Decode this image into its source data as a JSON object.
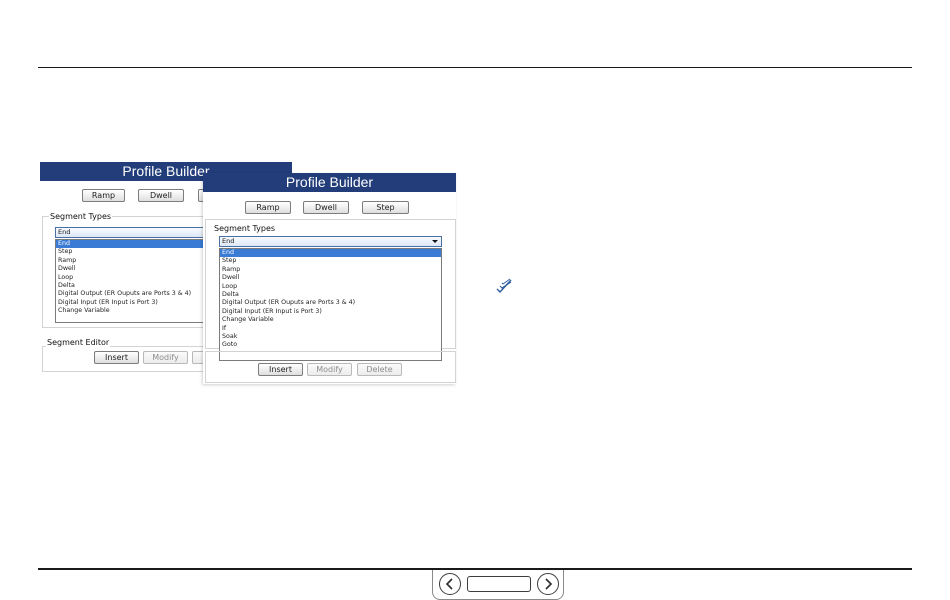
{
  "back_window": {
    "title": "Profile Builder",
    "toolbar": {
      "ramp": "Ramp",
      "dwell": "Dwell"
    },
    "segment_types_label": "Segment Types",
    "combo_value": "End",
    "list_items": [
      "End",
      "Step",
      "Ramp",
      "Dwell",
      "Loop",
      "Delta",
      "Digital Output (ER Ouputs are Ports 3 & 4)",
      "Digital Input (ER Input is Port 3)",
      "Change Variable"
    ],
    "segment_editor_label": "Segment Editor",
    "editor_buttons": {
      "insert": "Insert",
      "modify": "Modify"
    }
  },
  "front_window": {
    "title": "Profile Builder",
    "toolbar": {
      "ramp": "Ramp",
      "dwell": "Dwell",
      "step": "Step"
    },
    "segment_types_label": "Segment Types",
    "combo_value": "End",
    "list_items": [
      "End",
      "Step",
      "Ramp",
      "Dwell",
      "Loop",
      "Delta",
      "Digital Output (ER Ouputs are Ports 3 & 4)",
      "Digital Input (ER Input is Port 3)",
      "Change Variable",
      "If",
      "Soak",
      "Goto"
    ],
    "editor_buttons": {
      "insert": "Insert",
      "modify": "Modify",
      "delete": "Delete"
    }
  },
  "icons": {
    "checkmark": "double-check-icon",
    "prev": "chevron-left-icon",
    "next": "chevron-right-icon"
  },
  "pager": {
    "page_value": ""
  },
  "colors": {
    "title_bar": "#223d7a",
    "selection": "#3a7bd5"
  }
}
